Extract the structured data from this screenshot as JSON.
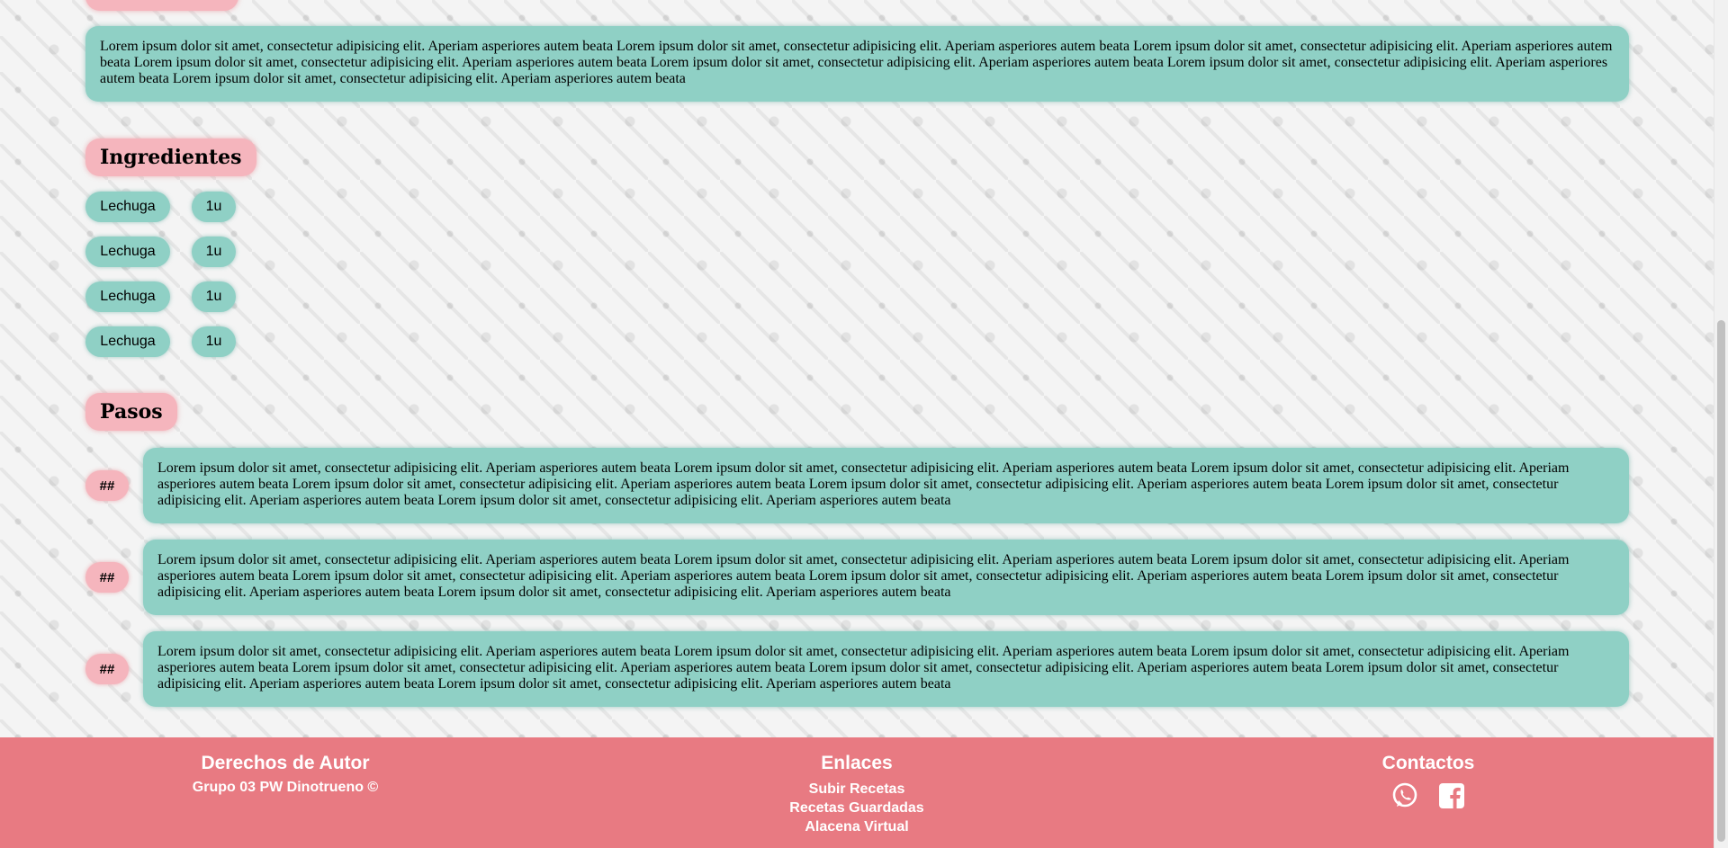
{
  "description": {
    "text": "Lorem ipsum dolor sit amet, consectetur adipisicing elit. Aperiam asperiores autem beata Lorem ipsum dolor sit amet, consectetur adipisicing elit. Aperiam asperiores autem beata Lorem ipsum dolor sit amet, consectetur adipisicing elit. Aperiam asperiores autem beata Lorem ipsum dolor sit amet, consectetur adipisicing elit. Aperiam asperiores autem beata Lorem ipsum dolor sit amet, consectetur adipisicing elit. Aperiam asperiores autem beata Lorem ipsum dolor sit amet, consectetur adipisicing elit. Aperiam asperiores autem beata Lorem ipsum dolor sit amet, consectetur adipisicing elit. Aperiam asperiores autem beata"
  },
  "ingredients": {
    "heading": "Ingredientes",
    "items": [
      {
        "name": "Lechuga",
        "qty": "1u"
      },
      {
        "name": "Lechuga",
        "qty": "1u"
      },
      {
        "name": "Lechuga",
        "qty": "1u"
      },
      {
        "name": "Lechuga",
        "qty": "1u"
      }
    ]
  },
  "steps": {
    "heading": "Pasos",
    "items": [
      {
        "num": "##",
        "text": "Lorem ipsum dolor sit amet, consectetur adipisicing elit. Aperiam asperiores autem beata Lorem ipsum dolor sit amet, consectetur adipisicing elit. Aperiam asperiores autem beata Lorem ipsum dolor sit amet, consectetur adipisicing elit. Aperiam asperiores autem beata Lorem ipsum dolor sit amet, consectetur adipisicing elit. Aperiam asperiores autem beata Lorem ipsum dolor sit amet, consectetur adipisicing elit. Aperiam asperiores autem beata Lorem ipsum dolor sit amet, consectetur adipisicing elit. Aperiam asperiores autem beata Lorem ipsum dolor sit amet, consectetur adipisicing elit. Aperiam asperiores autem beata"
      },
      {
        "num": "##",
        "text": "Lorem ipsum dolor sit amet, consectetur adipisicing elit. Aperiam asperiores autem beata Lorem ipsum dolor sit amet, consectetur adipisicing elit. Aperiam asperiores autem beata Lorem ipsum dolor sit amet, consectetur adipisicing elit. Aperiam asperiores autem beata Lorem ipsum dolor sit amet, consectetur adipisicing elit. Aperiam asperiores autem beata Lorem ipsum dolor sit amet, consectetur adipisicing elit. Aperiam asperiores autem beata Lorem ipsum dolor sit amet, consectetur adipisicing elit. Aperiam asperiores autem beata Lorem ipsum dolor sit amet, consectetur adipisicing elit. Aperiam asperiores autem beata"
      },
      {
        "num": "##",
        "text": "Lorem ipsum dolor sit amet, consectetur adipisicing elit. Aperiam asperiores autem beata Lorem ipsum dolor sit amet, consectetur adipisicing elit. Aperiam asperiores autem beata Lorem ipsum dolor sit amet, consectetur adipisicing elit. Aperiam asperiores autem beata Lorem ipsum dolor sit amet, consectetur adipisicing elit. Aperiam asperiores autem beata Lorem ipsum dolor sit amet, consectetur adipisicing elit. Aperiam asperiores autem beata Lorem ipsum dolor sit amet, consectetur adipisicing elit. Aperiam asperiores autem beata Lorem ipsum dolor sit amet, consectetur adipisicing elit. Aperiam asperiores autem beata"
      }
    ]
  },
  "footer": {
    "copyright": {
      "title": "Derechos de Autor",
      "text": "Grupo 03 PW Dinotrueno ©"
    },
    "links": {
      "title": "Enlaces",
      "items": [
        "Subir Recetas",
        "Recetas Guardadas",
        "Alacena Virtual"
      ]
    },
    "contacts": {
      "title": "Contactos",
      "icons": [
        "whatsapp-icon",
        "facebook-icon"
      ]
    }
  },
  "colors": {
    "teal": "#8fd0c5",
    "pink": "#f5b5bd",
    "footer": "#e87a82"
  }
}
